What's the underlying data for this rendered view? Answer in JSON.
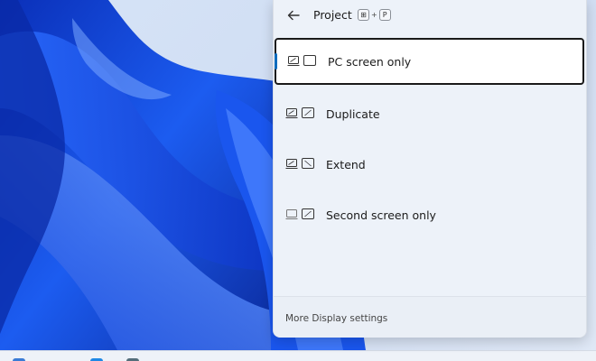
{
  "panel": {
    "title": "Project",
    "shortcut": {
      "key1": "⊞",
      "plus": "+",
      "key2": "P"
    },
    "options": [
      {
        "label": "PC screen only",
        "icon": "pc-screen-only-icon",
        "selected": true
      },
      {
        "label": "Duplicate",
        "icon": "duplicate-icon",
        "selected": false
      },
      {
        "label": "Extend",
        "icon": "extend-icon",
        "selected": false
      },
      {
        "label": "Second screen only",
        "icon": "second-screen-only-icon",
        "selected": false
      }
    ],
    "footer_link": "More Display settings"
  },
  "colors": {
    "accent": "#0f6cbd",
    "wallpaper_blue": "#1649d8"
  }
}
